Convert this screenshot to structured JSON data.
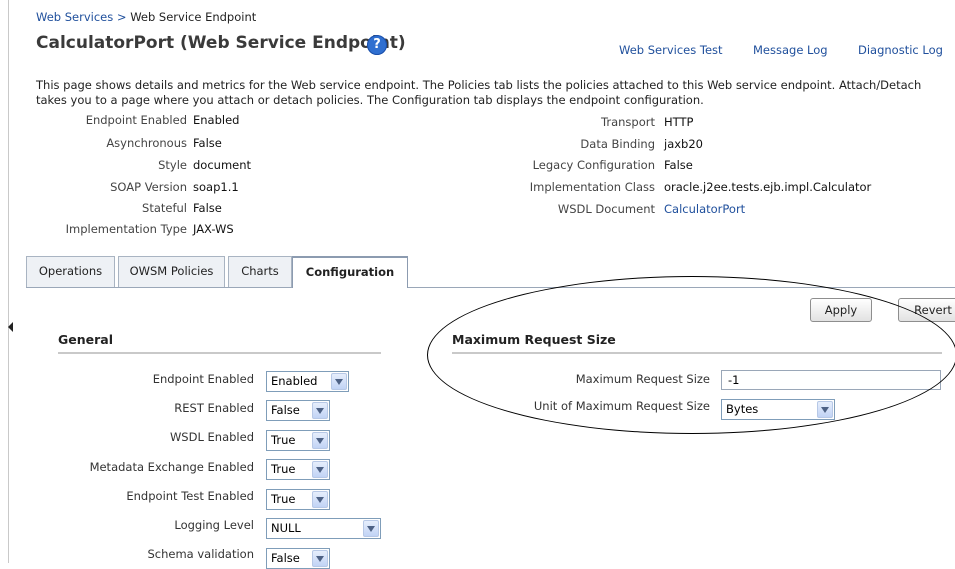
{
  "breadcrumb": {
    "parent": "Web Services",
    "separator": ">",
    "current": "Web Service Endpoint"
  },
  "page": {
    "title": "CalculatorPort (Web Service Endpoint)",
    "help_icon": "?",
    "links": {
      "ws_test": "Web Services Test",
      "message_log": "Message Log",
      "diagnostic_log": "Diagnostic Log"
    },
    "description": "This page shows details and metrics for the Web service endpoint. The Policies tab lists the policies attached to this Web service endpoint. Attach/Detach takes you to a page where you attach or detach policies. The Configuration tab displays the endpoint configuration."
  },
  "properties_left": [
    {
      "label": "Endpoint Enabled",
      "value": "Enabled"
    },
    {
      "label": "Asynchronous",
      "value": "False"
    },
    {
      "label": "Style",
      "value": "document"
    },
    {
      "label": "SOAP Version",
      "value": "soap1.1"
    },
    {
      "label": "Stateful",
      "value": "False"
    },
    {
      "label": "Implementation Type",
      "value": "JAX-WS"
    }
  ],
  "properties_right": [
    {
      "label": "Transport",
      "value": "HTTP"
    },
    {
      "label": "Data Binding",
      "value": "jaxb20"
    },
    {
      "label": "Legacy Configuration",
      "value": "False"
    },
    {
      "label": "Implementation Class",
      "value": "oracle.j2ee.tests.ejb.impl.Calculator"
    },
    {
      "label": "WSDL Document",
      "value": "CalculatorPort"
    }
  ],
  "tabs": [
    {
      "label": "Operations",
      "active": false
    },
    {
      "label": "OWSM Policies",
      "active": false
    },
    {
      "label": "Charts",
      "active": false
    },
    {
      "label": "Configuration",
      "active": true
    }
  ],
  "buttons": {
    "apply": "Apply",
    "revert": "Revert"
  },
  "general": {
    "title": "General",
    "fields": [
      {
        "label": "Endpoint Enabled",
        "value": "Enabled"
      },
      {
        "label": "REST Enabled",
        "value": "False"
      },
      {
        "label": "WSDL Enabled",
        "value": "True"
      },
      {
        "label": "Metadata Exchange Enabled",
        "value": "True"
      },
      {
        "label": "Endpoint Test Enabled",
        "value": "True"
      },
      {
        "label": "Logging Level",
        "value": "NULL"
      },
      {
        "label": "Schema validation",
        "value": "False"
      }
    ]
  },
  "max_request": {
    "title": "Maximum Request Size",
    "size_label": "Maximum Request Size",
    "size_value": "-1",
    "unit_label": "Unit of Maximum Request Size",
    "unit_value": "Bytes"
  },
  "icons": {
    "help": "help-icon",
    "dropdown": "chevron-down-icon",
    "collapse": "collapse-left-icon"
  },
  "colors": {
    "link": "#1f4f9c",
    "help_icon": "#2f6fd0",
    "tab_border": "#a9b4c2"
  }
}
